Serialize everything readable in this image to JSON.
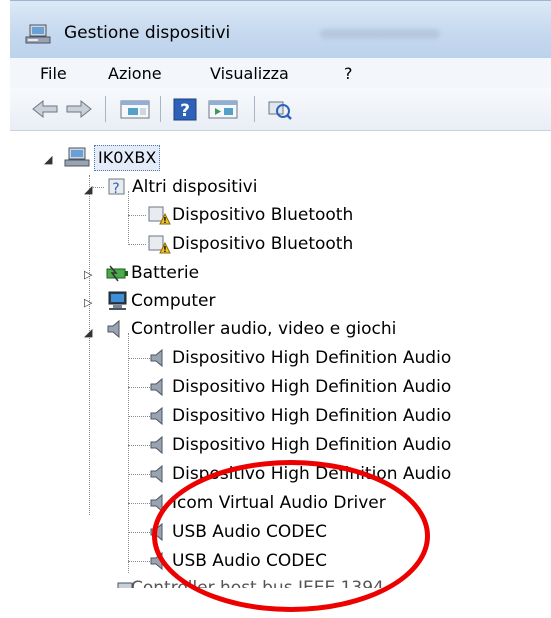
{
  "window": {
    "title": "Gestione dispositivi"
  },
  "menu": [
    "File",
    "Azione",
    "Visualizza",
    "?"
  ],
  "toolbar": {
    "icons": [
      "back-icon",
      "forward-icon",
      "show-hide-console-tree-icon",
      "help-icon",
      "properties-icon",
      "scan-hardware-icon"
    ],
    "help_glyph": "?"
  },
  "tree": {
    "root": "IK0XBX",
    "altri": {
      "label": "Altri dispositivi",
      "children": [
        "Dispositivo Bluetooth",
        "Dispositivo Bluetooth"
      ]
    },
    "batterie": "Batterie",
    "computer": "Computer",
    "audio": {
      "label": "Controller audio, video e giochi",
      "children": [
        "Dispositivo High Definition Audio",
        "Dispositivo High Definition Audio",
        "Dispositivo High Definition Audio",
        "Dispositivo High Definition Audio",
        "Dispositivo High Definition Audio",
        "Icom Virtual Audio Driver",
        "USB Audio CODEC",
        "USB Audio CODEC"
      ]
    },
    "partial": "Controller host bus IEEE 1394"
  },
  "annotation": {
    "color": "#ec0000"
  }
}
